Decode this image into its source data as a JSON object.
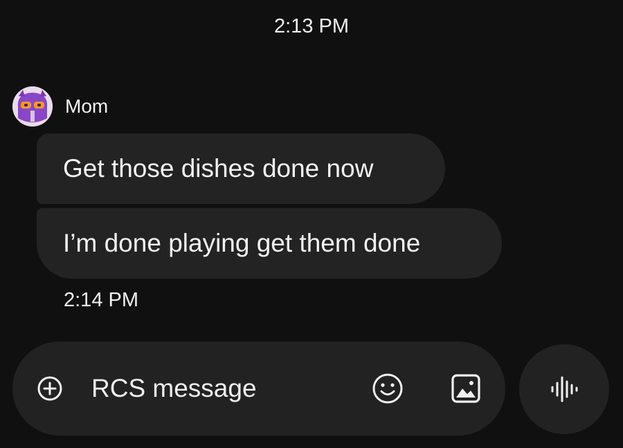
{
  "conversation": {
    "top_timestamp": "2:13 PM",
    "sender": {
      "name": "Mom",
      "avatar_icon": "purple-monster-avatar-icon"
    },
    "messages": [
      {
        "text": "Get those dishes done now"
      },
      {
        "text": "I’m done playing get them done"
      }
    ],
    "message_timestamp": "2:14 PM"
  },
  "composer": {
    "placeholder": "RCS message",
    "value": "",
    "add_icon": "add-circle-icon",
    "emoji_icon": "emoji-icon",
    "gallery_icon": "gallery-icon",
    "voice_icon": "voice-waveform-icon"
  },
  "colors": {
    "background": "#101010",
    "bubble": "#232323",
    "composer": "#222222",
    "text": "#f1f1f1"
  }
}
